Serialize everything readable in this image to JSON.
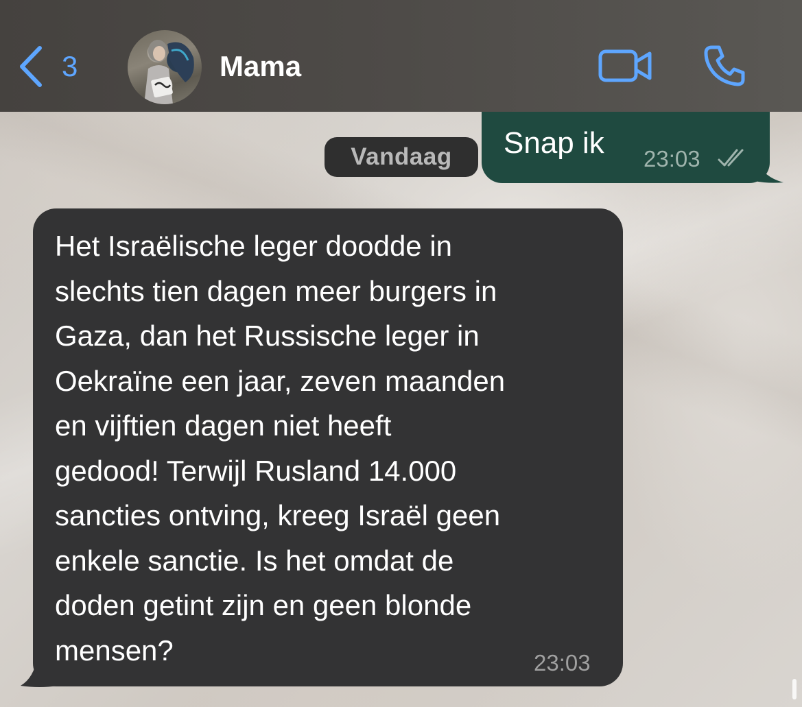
{
  "header": {
    "back_count": "3",
    "contact_name": "Mama",
    "accent_color": "#5ea6ff",
    "icons": [
      "chevron-left-icon",
      "video-call-icon",
      "phone-call-icon"
    ]
  },
  "chat": {
    "date_separator": "Vandaag",
    "messages": [
      {
        "direction": "outgoing",
        "text": "Snap ik",
        "time": "23:03",
        "status": "read",
        "bubble_color": "#1f4a40"
      },
      {
        "direction": "incoming",
        "text": "Het Israëlische leger doodde in\nslechts tien dagen meer burgers in\nGaza, dan het Russische leger in\nOekraïne een jaar, zeven maanden\nen vijftien dagen niet heeft\ngedood! Terwijl Rusland 14.000\nsancties ontving, kreeg Israël geen\nenkele sanctie. Is het omdat de\ndoden getint zijn  en geen blonde\nmensen?",
        "time": "23:03",
        "bubble_color": "#333334"
      }
    ]
  }
}
